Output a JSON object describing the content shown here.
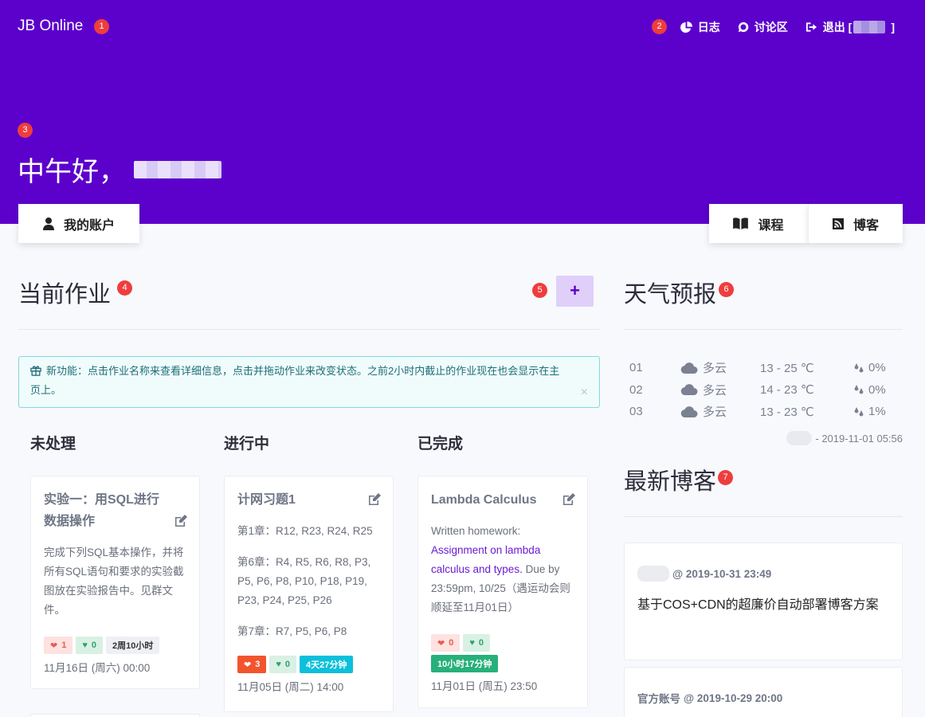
{
  "brand": "JB Online",
  "badges": {
    "b1": "1",
    "b2": "2",
    "b3": "3",
    "b4": "4",
    "b5": "5",
    "b6": "6",
    "b7": "7"
  },
  "nav": {
    "log": "日志",
    "forum": "讨论区",
    "logout": "退出 [",
    "logout_end": "]"
  },
  "greeting": "中午好，",
  "buttons": {
    "account": "我的账户",
    "courses": "课程",
    "blogs": "博客",
    "add": "+"
  },
  "assignments": {
    "heading": "当前作业",
    "notice": "新功能：点击作业名称来查看详细信息，点击并拖动作业来改变状态。之前2小时内截止的作业现在也会显示在主页上。",
    "notice_close": "×",
    "columns": [
      {
        "title": "未处理",
        "card": {
          "title": "实验一：用SQL进行数据操作",
          "body": "完成下列SQL基本操作，并将所有SQL语句和要求的实验截图放在实验报告中。见群文件。",
          "likes": "1",
          "hearts": "0",
          "remaining": "2周10小时",
          "due": "11月16日 (周六) 00:00"
        }
      },
      {
        "title": "进行中",
        "card": {
          "title": "计网习题1",
          "lines": [
            "第1章：R12, R23, R24, R25",
            "第6章：R4, R5, R6, R8, P3, P5, P6, P8, P10, P18, P19, P23, P24, P25, P26",
            "第7章：R7, P5, P6, P8"
          ],
          "likes": "3",
          "hearts": "0",
          "remaining": "4天27分钟",
          "due": "11月05日 (周二) 14:00"
        }
      },
      {
        "title": "已完成",
        "card": {
          "title": "Lambda Calculus",
          "body_pre": "Written homework: ",
          "body_link": "Assignment on lambda calculus and types.",
          "body_post": " Due by 23:59pm, 10/25（遇运动会则顺延至11月01日）",
          "likes": "0",
          "hearts": "0",
          "remaining": "10小时17分钟",
          "due": "11月01日 (周五) 23:50"
        }
      }
    ]
  },
  "weather": {
    "heading": "天气预报",
    "rows": [
      {
        "day": "01",
        "sky": "多云",
        "temp": "13 - 25 ℃",
        "precip": "0%"
      },
      {
        "day": "02",
        "sky": "多云",
        "temp": "14 - 23 ℃",
        "precip": "0%"
      },
      {
        "day": "03",
        "sky": "多云",
        "temp": "13 - 23 ℃",
        "precip": "1%"
      }
    ],
    "updated": "- 2019-11-01 05:56"
  },
  "blogs": {
    "heading": "最新博客",
    "items": [
      {
        "author": "",
        "time": "@ 2019-10-31 23:49",
        "title": "基于COS+CDN的超廉价自动部署博客方案"
      },
      {
        "author": "官方账号",
        "time": "@ 2019-10-29 20:00",
        "title": ""
      }
    ]
  },
  "colors": {
    "primary": "#5c00cc",
    "badge": "#ee3d3d",
    "notice": "#7fd9dc"
  }
}
